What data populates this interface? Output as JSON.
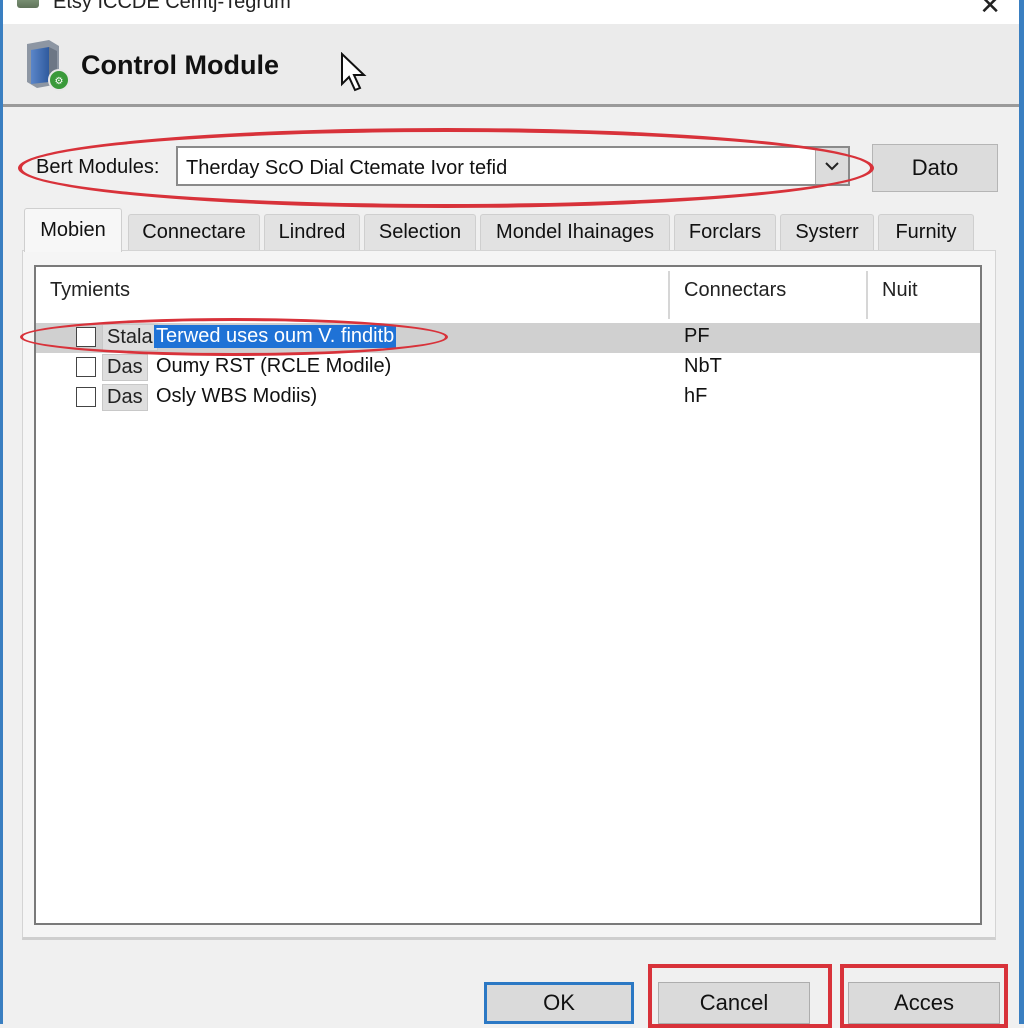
{
  "window": {
    "title": "Etsy ICCDE Cemtj-Tegrum",
    "close_icon": "close-icon"
  },
  "header": {
    "title": "Control Module",
    "icon": "server-module-icon"
  },
  "selector": {
    "label": "Bert Modules:",
    "value": "Therday ScO Dial Ctemate Ivor tefid",
    "dropdown_icon": "chevron-down-icon",
    "button_label": "Dato"
  },
  "tabs": [
    {
      "label": "Mobien",
      "active": true
    },
    {
      "label": "Connectare",
      "active": false
    },
    {
      "label": "Lindred",
      "active": false
    },
    {
      "label": "Selection",
      "active": false
    },
    {
      "label": "Mondel Ihainages",
      "active": false
    },
    {
      "label": "Forclars",
      "active": false
    },
    {
      "label": "Systerr",
      "active": false
    },
    {
      "label": "Furnity",
      "active": false
    }
  ],
  "list": {
    "columns": [
      "Tymients",
      "Connectars",
      "Nuit"
    ],
    "rows": [
      {
        "checked": false,
        "tag": "Stala",
        "name": "Terwed uses oum V. finditb",
        "connector": "PF",
        "unit": "",
        "selected": true
      },
      {
        "checked": false,
        "tag": "Das",
        "name": "Oumy RST (RCLE Modile)",
        "connector": "NbT",
        "unit": "",
        "selected": false
      },
      {
        "checked": false,
        "tag": "Das",
        "name": "Osly WBS Modiis)",
        "connector": "hF",
        "unit": "",
        "selected": false
      }
    ]
  },
  "buttons": {
    "ok": "OK",
    "cancel": "Cancel",
    "acces": "Acces"
  },
  "colors": {
    "highlight_red": "#d8323a",
    "selection_blue": "#1f72d6",
    "focus_blue": "#2b78c4"
  }
}
